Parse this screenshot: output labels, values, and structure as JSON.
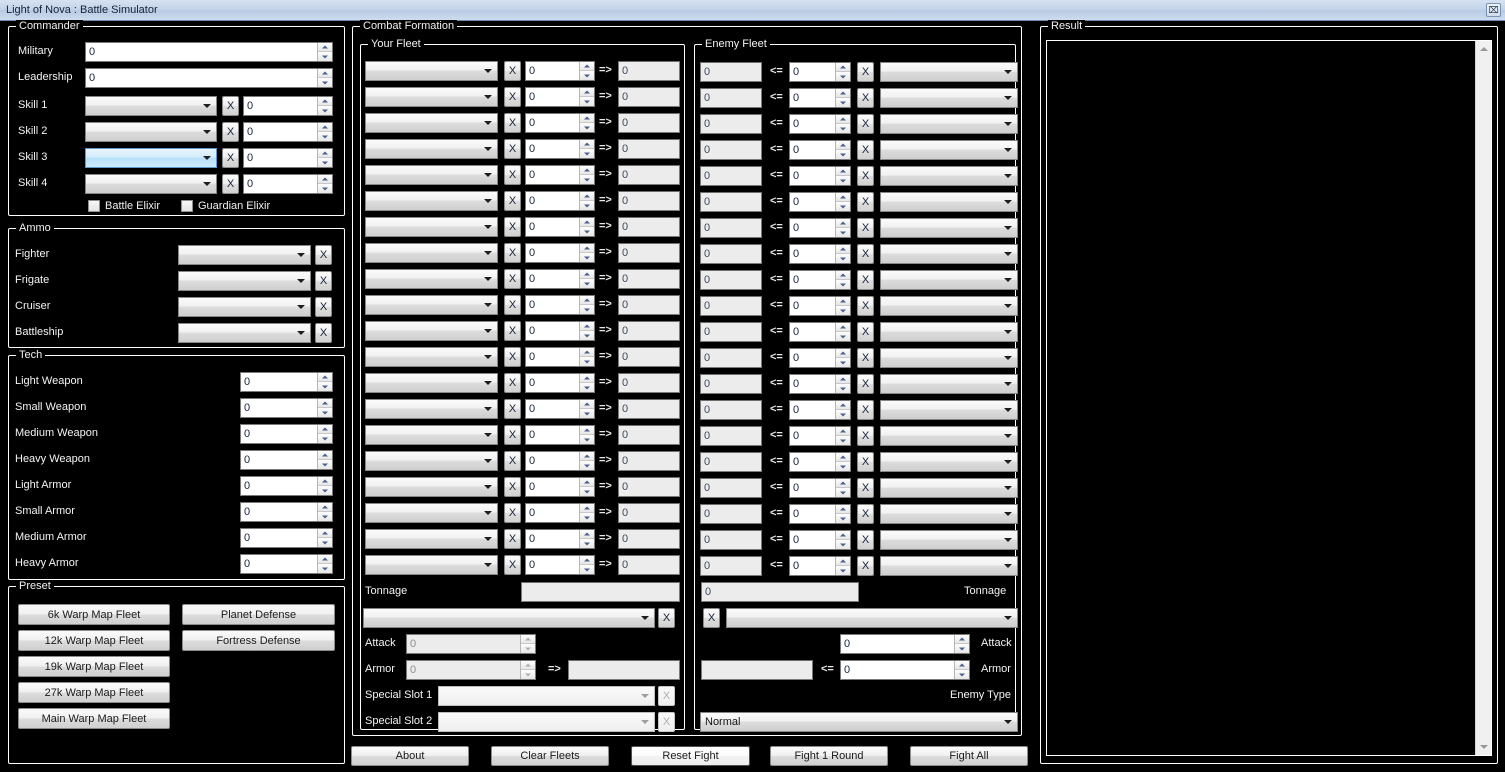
{
  "window": {
    "title": "Light of Nova : Battle Simulator",
    "close_label": "⌧"
  },
  "commander": {
    "title": "Commander",
    "military_label": "Military",
    "military_value": "0",
    "leadership_label": "Leadership",
    "leadership_value": "0",
    "skills": [
      {
        "label": "Skill 1",
        "combo": "",
        "clear": "X",
        "value": "0",
        "selected": false
      },
      {
        "label": "Skill 2",
        "combo": "",
        "clear": "X",
        "value": "0",
        "selected": false
      },
      {
        "label": "Skill 3",
        "combo": "",
        "clear": "X",
        "value": "0",
        "selected": true
      },
      {
        "label": "Skill 4",
        "combo": "",
        "clear": "X",
        "value": "0",
        "selected": false
      }
    ],
    "battle_elixir_label": "Battle Elixir",
    "guardian_elixir_label": "Guardian Elixir"
  },
  "ammo": {
    "title": "Ammo",
    "rows": [
      {
        "label": "Fighter",
        "combo": "",
        "clear": "X"
      },
      {
        "label": "Frigate",
        "combo": "",
        "clear": "X"
      },
      {
        "label": "Cruiser",
        "combo": "",
        "clear": "X"
      },
      {
        "label": "Battleship",
        "combo": "",
        "clear": "X"
      }
    ]
  },
  "tech": {
    "title": "Tech",
    "rows": [
      {
        "label": "Light Weapon",
        "value": "0"
      },
      {
        "label": "Small Weapon",
        "value": "0"
      },
      {
        "label": "Medium Weapon",
        "value": "0"
      },
      {
        "label": "Heavy Weapon",
        "value": "0"
      },
      {
        "label": "Light Armor",
        "value": "0"
      },
      {
        "label": "Small Armor",
        "value": "0"
      },
      {
        "label": "Medium Armor",
        "value": "0"
      },
      {
        "label": "Heavy Armor",
        "value": "0"
      }
    ]
  },
  "preset": {
    "title": "Preset",
    "left_buttons": [
      "6k Warp Map Fleet",
      "12k Warp Map Fleet",
      "19k Warp Map Fleet",
      "27k Warp Map Fleet",
      "Main Warp Map Fleet"
    ],
    "right_buttons": [
      "Planet Defense",
      "Fortress Defense"
    ]
  },
  "combat": {
    "title": "Combat Formation",
    "your_fleet": {
      "title": "Your Fleet",
      "row_count": 20,
      "row_template": {
        "combo": "",
        "clear": "X",
        "count": "0",
        "arrow": "=>",
        "result": "0"
      },
      "tonnage_label": "Tonnage",
      "tonnage_value": "",
      "ship_combo": "",
      "ship_clear": "X",
      "attack_label": "Attack",
      "attack_value": "0",
      "armor_label": "Armor",
      "armor_value": "0",
      "armor_arrow": "=>",
      "armor_result": "",
      "special1_label": "Special Slot 1",
      "special1_combo": "",
      "special1_clear": "X",
      "special2_label": "Special Slot 2",
      "special2_combo": "",
      "special2_clear": "X"
    },
    "enemy_fleet": {
      "title": "Enemy Fleet",
      "row_count": 20,
      "row_template": {
        "result": "0",
        "arrow": "<=",
        "count": "0",
        "clear": "X",
        "combo": ""
      },
      "tonnage_label": "Tonnage",
      "tonnage_value": "0",
      "ship_clear": "X",
      "ship_combo": "",
      "attack_label": "Attack",
      "attack_value": "0",
      "armor_label": "Armor",
      "armor_value": "0",
      "armor_arrow": "<=",
      "armor_result": "",
      "enemy_type_label": "Enemy Type",
      "enemy_type_value": "Normal"
    }
  },
  "result": {
    "title": "Result",
    "content": ""
  },
  "actions": {
    "about": "About",
    "clear_fleets": "Clear Fleets",
    "reset_fight": "Reset Fight",
    "fight_1_round": "Fight 1 Round",
    "fight_all": "Fight All"
  },
  "colors": {
    "background": "#000000",
    "border": "#ffffff",
    "text": "#f2f2f2",
    "titlebar": "#c3d3e8",
    "selected_combo": "#b7e0f8"
  }
}
